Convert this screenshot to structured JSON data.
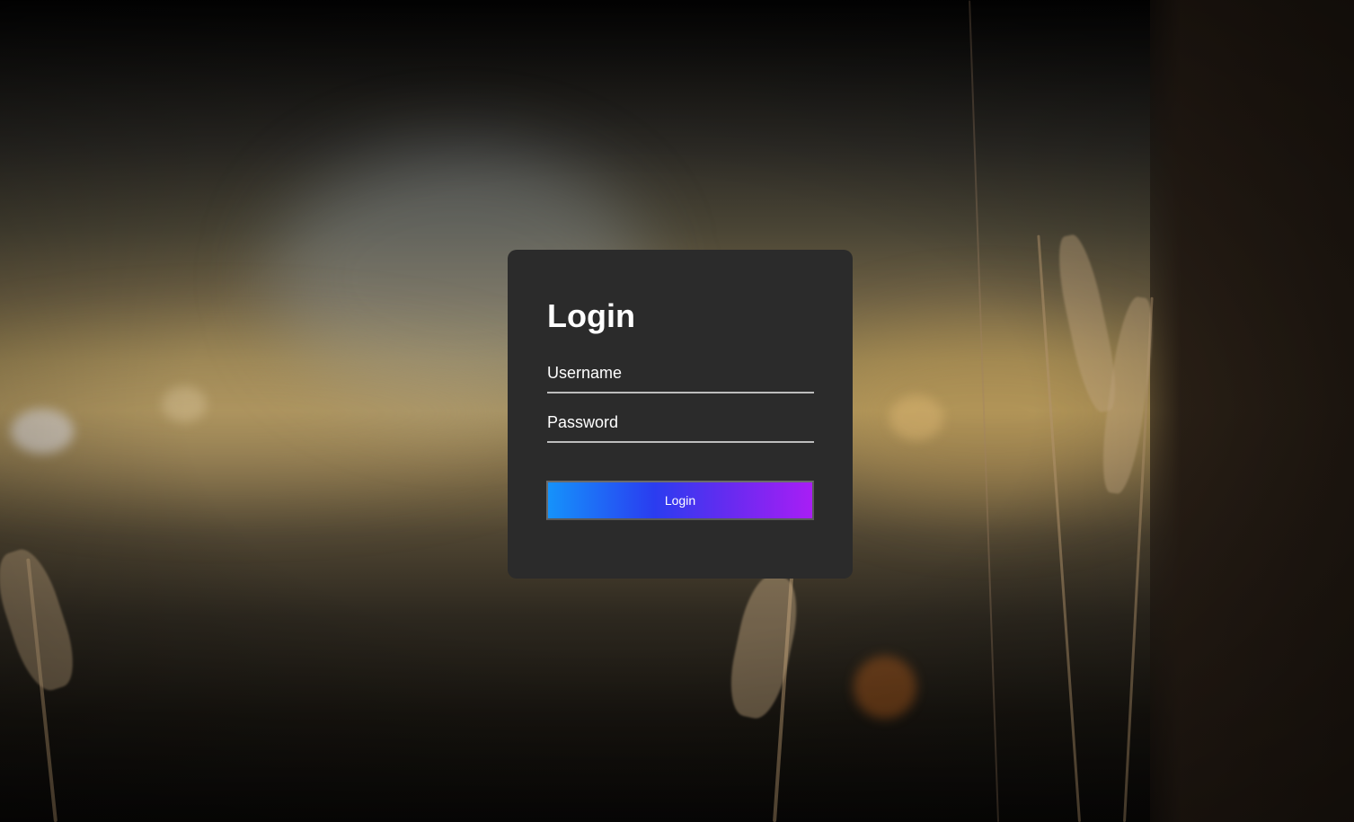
{
  "login_card": {
    "title": "Login",
    "username_field": {
      "label": "Username",
      "value": ""
    },
    "password_field": {
      "label": "Password",
      "value": ""
    },
    "submit_label": "Login"
  },
  "colors": {
    "card_background": "#2b2b2b",
    "button_gradient_start": "#1592fb",
    "button_gradient_end": "#a81ef5",
    "field_underline": "#bdbdbd",
    "text": "#ffffff"
  }
}
